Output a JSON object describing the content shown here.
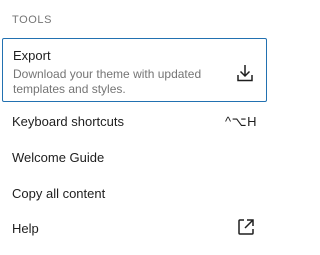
{
  "menu": {
    "group_label": "TOOLS",
    "export": {
      "label": "Export",
      "description": "Download your theme with updated templates and styles.",
      "icon": "download-icon"
    },
    "items": [
      {
        "label": "Keyboard shortcuts",
        "shortcut": "^⌥H"
      },
      {
        "label": "Welcome Guide"
      },
      {
        "label": "Copy all content"
      },
      {
        "label": "Help",
        "icon": "external-link-icon"
      }
    ]
  },
  "colors": {
    "focus_border": "#2271b1",
    "text": "#1e1e1e",
    "muted": "#757575"
  }
}
